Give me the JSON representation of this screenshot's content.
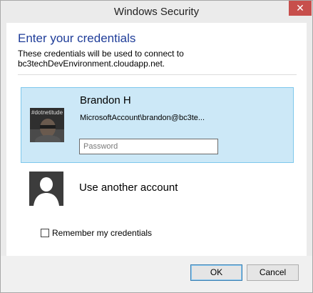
{
  "window": {
    "title": "Windows Security",
    "close_symbol": "✕"
  },
  "dialog": {
    "heading": "Enter your credentials",
    "description_line1": "These credentials will be used to connect to",
    "description_line2": "bc3techDevEnvironment.cloudapp.net."
  },
  "selected_account": {
    "name": "Brandon H",
    "account": "MicrosoftAccount\\brandon@bc3te...",
    "avatar_tag": "#dotnetitude",
    "password_placeholder": "Password",
    "password_value": ""
  },
  "other_account": {
    "label": "Use another account"
  },
  "remember": {
    "label": "Remember my credentials",
    "checked": false
  },
  "buttons": {
    "ok": "OK",
    "cancel": "Cancel"
  },
  "colors": {
    "accent_heading": "#1f3d99",
    "selected_bg": "#cce8f7",
    "selected_border": "#7ec8ec",
    "close_red": "#c74f4c"
  }
}
